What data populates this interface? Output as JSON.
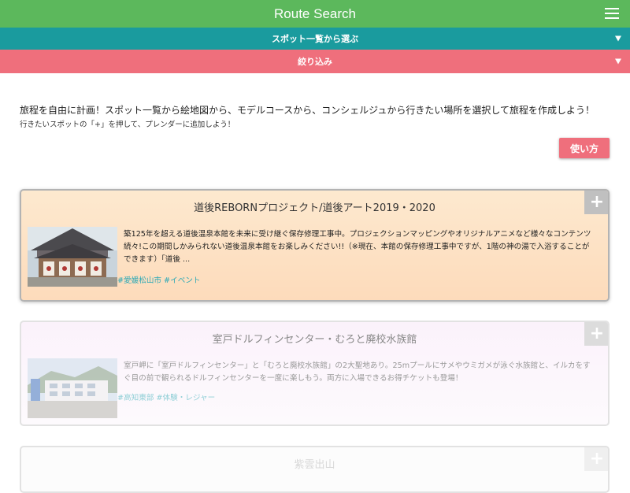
{
  "header": {
    "title": "Route Search",
    "menu_icon": "hamburger-icon"
  },
  "filters": {
    "spot_list_label": "スポット一覧から選ぶ",
    "narrow_label": "絞り込み",
    "teal_color": "#1a9b9e",
    "pink_color": "#ef6f7c"
  },
  "intro": {
    "line1": "旅程を自由に計画！スポット一覧から絵地図から、モデルコースから、コンシェルジュから行きたい場所を選択して旅程を作成しよう！",
    "line2": "行きたいスポットの「+」を押して、プレンダーに追加しよう！"
  },
  "howto_button": "使い方",
  "spots": [
    {
      "title": "道後REBORNプロジェクト/道後アート2019・2020",
      "desc": "築125年を超える道後温泉本館を未来に受け継ぐ保存修理工事中。プロジェクションマッピングやオリジナルアニメなど様々なコンテンツ続々!この期間しかみられない道後温泉本館をお楽しみください!!（※現在、本館の保存修理工事中ですが、1階の神の湯で入浴することができます）「道後 ...",
      "tags": "#愛媛松山市 #イベント",
      "add_label": "+"
    },
    {
      "title": "室戸ドルフィンセンター・むろと廃校水族館",
      "desc": "室戸岬に「室戸ドルフィンセンター」と「むろと廃校水族館」の2大聖地あり。25mプールにサメやウミガメが泳ぐ水族館と、イルカをすぐ目の前で観られるドルフィンセンターを一度に楽しもう。両方に入場できるお得チケットも登場！",
      "tags": "#高知東部 #体験・レジャー",
      "add_label": "+"
    },
    {
      "title": "紫雲出山",
      "add_label": "+"
    }
  ]
}
